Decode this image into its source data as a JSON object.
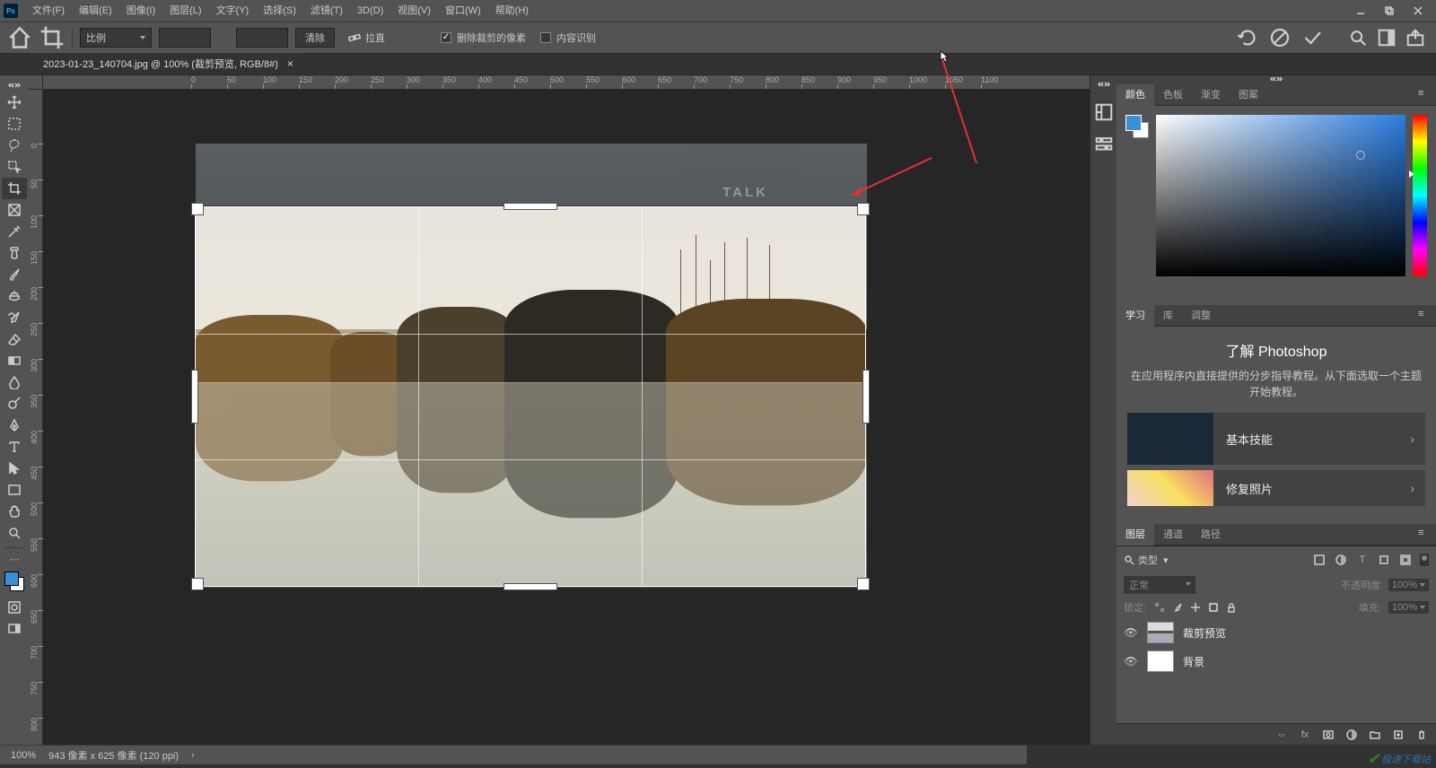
{
  "menu": {
    "file": "文件(F)",
    "edit": "编辑(E)",
    "image": "图像(I)",
    "layer": "图层(L)",
    "type": "文字(Y)",
    "select": "选择(S)",
    "filter": "滤镜(T)",
    "three_d": "3D(D)",
    "view": "视图(V)",
    "window": "窗口(W)",
    "help": "帮助(H)"
  },
  "options": {
    "ratio_mode": "比例",
    "width": "",
    "height": "",
    "clear": "清除",
    "straighten": "拉直",
    "delete_cropped": "删除裁剪的像素",
    "delete_checked": true,
    "content_aware": "内容识别",
    "content_checked": false
  },
  "tab": {
    "title": "2023-01-23_140704.jpg @ 100% (裁剪预览, RGB/8#)"
  },
  "ruler_h": [
    "0",
    "50",
    "100",
    "150",
    "200",
    "250",
    "300",
    "350",
    "400",
    "450",
    "500",
    "550",
    "600",
    "650",
    "700",
    "750",
    "800",
    "850",
    "900",
    "950",
    "1000",
    "1050",
    "1100"
  ],
  "ruler_v": [
    "0",
    "50",
    "100",
    "150",
    "200",
    "250",
    "300",
    "350",
    "400",
    "450",
    "500",
    "550",
    "600",
    "650",
    "700",
    "750",
    "800"
  ],
  "panels": {
    "color": {
      "tab_color": "颜色",
      "tab_swatches": "色板",
      "tab_gradient": "渐变",
      "tab_pattern": "图案"
    },
    "learn": {
      "tab_learn": "学习",
      "tab_lib": "库",
      "tab_adjust": "调整",
      "title": "了解 Photoshop",
      "desc": "在应用程序内直接提供的分步指导教程。从下面选取一个主题开始教程。",
      "item1": "基本技能",
      "item2": "修复照片"
    },
    "layers": {
      "tab_layers": "图层",
      "tab_channels": "通道",
      "tab_paths": "路径",
      "filter_kind": "类型",
      "blend_mode": "正常",
      "opacity_label": "不透明度:",
      "opacity": "100%",
      "lock_label": "锁定:",
      "fill_label": "填充:",
      "fill": "100%",
      "layer0": "裁剪预览",
      "layer1": "背景"
    }
  },
  "status": {
    "zoom": "100%",
    "dims": "943 像素 x 625 像素 (120 ppi)"
  },
  "colors": {
    "fg": "#3b8fd4",
    "bg": "#ffffff",
    "accent": "#3a7bbf",
    "arrow": "#e43030"
  },
  "canvas_watermark": "TALK"
}
